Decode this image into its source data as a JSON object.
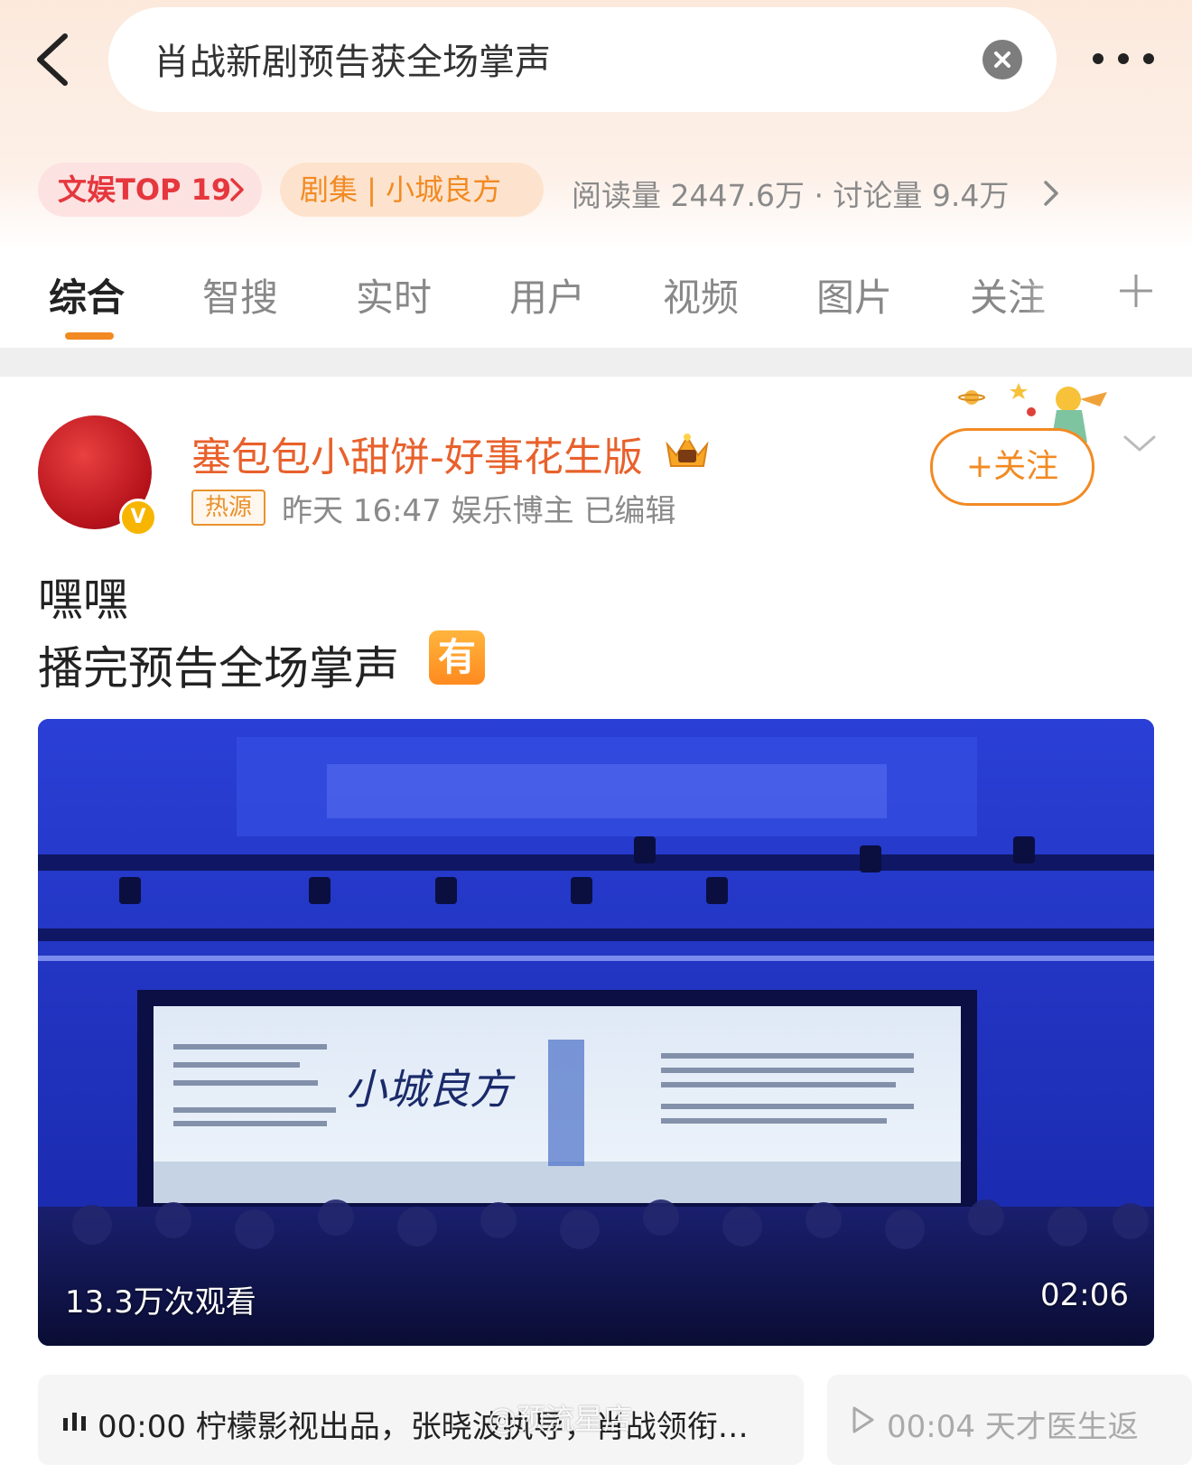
{
  "search": {
    "query": "肖战新剧预告获全场掌声"
  },
  "topic_bar": {
    "rank_tag": "文娱TOP 19",
    "category_tag": "剧集 | 小城良方",
    "stats": "阅读量 2447.6万 · 讨论量 9.4万"
  },
  "tabs": [
    {
      "label": "综合",
      "active": true
    },
    {
      "label": "智搜"
    },
    {
      "label": "实时"
    },
    {
      "label": "用户"
    },
    {
      "label": "视频"
    },
    {
      "label": "图片"
    },
    {
      "label": "关注"
    }
  ],
  "post": {
    "username": "塞包包小甜饼-好事花生版",
    "hot_label": "热源",
    "meta": "昨天 16:47  娱乐博主  已编辑",
    "follow_label": "+关注",
    "verified_badge": "V",
    "line1": "嘿嘿",
    "line2": "播完预告全场掌声",
    "emoji_label": "有"
  },
  "video": {
    "views": "13.3万次观看",
    "duration": "02:06",
    "screen_title": "小城良方"
  },
  "chapters": [
    {
      "text": "00:00 柠檬影视出品，张晓波执导，肖战领衔…",
      "state": "playing"
    },
    {
      "text": "00:04 天才医生返",
      "state": "idle"
    }
  ],
  "watermark": "@预流星店",
  "colors": {
    "accent": "#f28a23",
    "username": "#e8612c",
    "rank_red": "#e5373d",
    "video_blue": "#1a2aa0"
  },
  "icons": [
    "back-icon",
    "clear-icon",
    "more-icon",
    "chevron-right-icon",
    "plus-icon",
    "chevron-down-icon",
    "crown-icon",
    "verified-icon",
    "audio-bars-icon",
    "play-icon"
  ]
}
